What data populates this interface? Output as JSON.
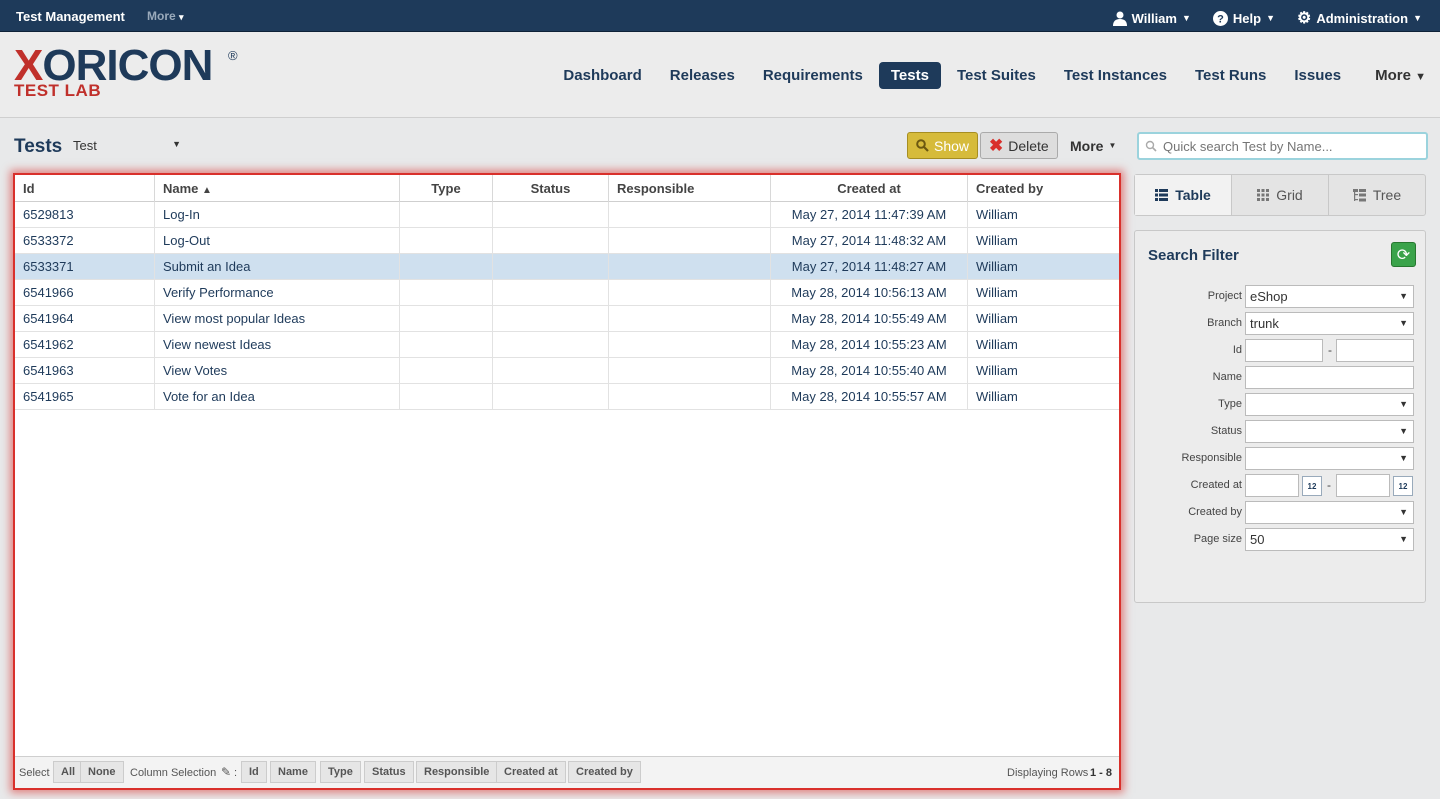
{
  "topbar": {
    "app_name": "Test Management",
    "more": "More",
    "user": "William",
    "help": "Help",
    "admin": "Administration"
  },
  "logo": {
    "brand_x": "X",
    "brand_rest": "ORICON",
    "registered": "®",
    "sub": "TEST LAB"
  },
  "nav": {
    "items": [
      "Dashboard",
      "Releases",
      "Requirements",
      "Tests",
      "Test Suites",
      "Test Instances",
      "Test Runs",
      "Issues"
    ],
    "active": "Tests",
    "more": "More"
  },
  "page": {
    "title": "Tests",
    "selector_value": "Test"
  },
  "toolbar": {
    "show_label": "Show",
    "delete_label": "Delete",
    "more_label": "More"
  },
  "search": {
    "placeholder": "Quick search Test by Name..."
  },
  "table": {
    "columns": [
      "Id",
      "Name",
      "Type",
      "Status",
      "Responsible",
      "Created at",
      "Created by"
    ],
    "sort_indicator": "^",
    "rows": [
      {
        "id": "6529813",
        "name": "Log-In",
        "type": "",
        "status": "",
        "responsible": "",
        "created_at": "May 27, 2014 11:47:39 AM",
        "created_by": "William"
      },
      {
        "id": "6533372",
        "name": "Log-Out",
        "type": "",
        "status": "",
        "responsible": "",
        "created_at": "May 27, 2014 11:48:32 AM",
        "created_by": "William"
      },
      {
        "id": "6533371",
        "name": "Submit an Idea",
        "type": "",
        "status": "",
        "responsible": "",
        "created_at": "May 27, 2014 11:48:27 AM",
        "created_by": "William"
      },
      {
        "id": "6541966",
        "name": "Verify Performance",
        "type": "",
        "status": "",
        "responsible": "",
        "created_at": "May 28, 2014 10:56:13 AM",
        "created_by": "William"
      },
      {
        "id": "6541964",
        "name": "View most popular Ideas",
        "type": "",
        "status": "",
        "responsible": "",
        "created_at": "May 28, 2014 10:55:49 AM",
        "created_by": "William"
      },
      {
        "id": "6541962",
        "name": "View newest Ideas",
        "type": "",
        "status": "",
        "responsible": "",
        "created_at": "May 28, 2014 10:55:23 AM",
        "created_by": "William"
      },
      {
        "id": "6541963",
        "name": "View Votes",
        "type": "",
        "status": "",
        "responsible": "",
        "created_at": "May 28, 2014 10:55:40 AM",
        "created_by": "William"
      },
      {
        "id": "6541965",
        "name": "Vote for an Idea",
        "type": "",
        "status": "",
        "responsible": "",
        "created_at": "May 28, 2014 10:55:57 AM",
        "created_by": "William"
      }
    ],
    "selected_row_id": "6533371"
  },
  "footer": {
    "select_label": "Select",
    "all": "All",
    "none": "None",
    "column_selection": "Column Selection",
    "colon": ":",
    "column_buttons": [
      "Id",
      "Name",
      "Type",
      "Status",
      "Responsible",
      "Created at",
      "Created by"
    ],
    "displaying_rows": "Displaying Rows",
    "range": "1 - 8"
  },
  "views": {
    "table": "Table",
    "grid": "Grid",
    "tree": "Tree",
    "active": "Table"
  },
  "filter": {
    "title": "Search Filter",
    "project_label": "Project",
    "project_value": "eShop",
    "branch_label": "Branch",
    "branch_value": "trunk",
    "id_label": "Id",
    "name_label": "Name",
    "type_label": "Type",
    "status_label": "Status",
    "responsible_label": "Responsible",
    "created_at_label": "Created at",
    "created_by_label": "Created by",
    "page_size_label": "Page size",
    "page_size_value": "50",
    "range_dash": "-",
    "calendar_day": "12"
  },
  "colors": {
    "brand_navy": "#1e3a5a",
    "brand_red": "#c0302b",
    "show_button": "#d6bb3b",
    "selected_row": "#cfe0ef",
    "highlight_border": "#d9302b"
  }
}
